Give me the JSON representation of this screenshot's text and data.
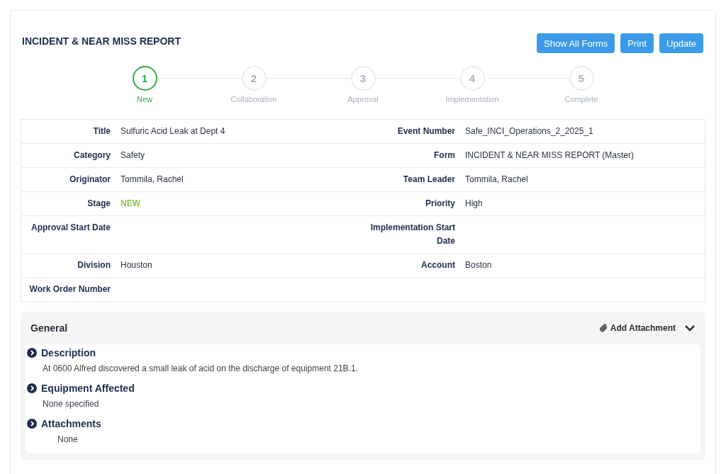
{
  "title": "INCIDENT & NEAR MISS REPORT",
  "buttons": [
    "Show All Forms",
    "Print",
    "Update"
  ],
  "steps": [
    {
      "number": "1",
      "label": "New",
      "selected": true
    },
    {
      "number": "2",
      "label": "Collaboration",
      "selected": false
    },
    {
      "number": "3",
      "label": "Approval",
      "selected": false
    },
    {
      "number": "4",
      "label": "Implementation",
      "selected": false
    },
    {
      "number": "5",
      "label": "Complete",
      "selected": false
    }
  ],
  "details": [
    {
      "left": {
        "label": "Title",
        "value": "Sulfuric Acid Leak at Dept 4",
        "kind": "text"
      },
      "right": {
        "label": "Event Number",
        "value": "Safe_INCI_Operations_2_2025_1",
        "kind": "text"
      }
    },
    {
      "left": {
        "label": "Category",
        "value": "Safety",
        "kind": "text"
      },
      "right": {
        "label": "Form",
        "value": "INCIDENT & NEAR MISS REPORT (Master)",
        "kind": "text"
      }
    },
    {
      "left": {
        "label": "Originator",
        "value": "Tommila, Rachel",
        "kind": "text"
      },
      "right": {
        "label": "Team Leader",
        "value": "Tommila, Rachel",
        "kind": "text"
      }
    },
    {
      "left": {
        "label": "Stage",
        "value": "NEW",
        "kind": "status"
      },
      "right": {
        "label": "Priority",
        "value": "High",
        "kind": "text"
      }
    },
    {
      "left": {
        "label": "Approval Start Date",
        "kind": "text"
      },
      "right": {
        "label": "Implementation Start Date",
        "kind": "text"
      }
    },
    {
      "left": {
        "label": "Division",
        "value": "Houston",
        "kind": "text"
      },
      "right": {
        "label": "Account",
        "value": "Boston",
        "kind": "text"
      }
    },
    {
      "left": {
        "label": "Work Order Number",
        "kind": "text"
      }
    }
  ],
  "general": {
    "title": "General",
    "add_attachment": "Add Attachment",
    "expanded": true,
    "sections": [
      {
        "title": "Description",
        "text": "At 0600 Alfred discovered a small leak of acid on the discharge of equipment 21B.1.",
        "kind": "text"
      },
      {
        "title": "Equipment Affected",
        "text": "None specified",
        "kind": "text"
      },
      {
        "title": "Attachments",
        "text": "None",
        "kind": "list"
      }
    ]
  }
}
